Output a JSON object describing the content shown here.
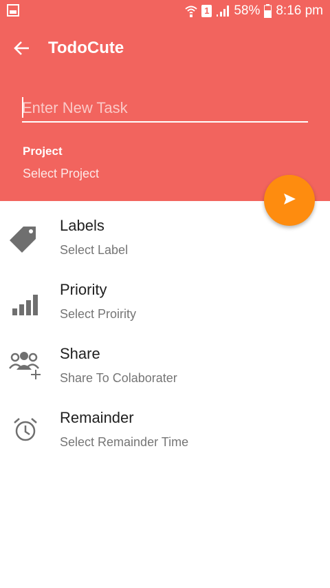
{
  "status_bar": {
    "sim_label": "1",
    "battery": "58%",
    "time": "8:16 pm"
  },
  "app_bar": {
    "title": "TodoCute"
  },
  "task_input": {
    "placeholder": "Enter New Task",
    "value": ""
  },
  "project": {
    "label": "Project",
    "value": "Select Project"
  },
  "options": [
    {
      "title": "Labels",
      "subtitle": "Select Label",
      "icon": "label-tag-icon"
    },
    {
      "title": "Priority",
      "subtitle": "Select Proirity",
      "icon": "signal-bars-icon"
    },
    {
      "title": "Share",
      "subtitle": "Share To Colaborater",
      "icon": "group-add-icon"
    },
    {
      "title": "Remainder",
      "subtitle": "Select Remainder Time",
      "icon": "alarm-clock-icon"
    }
  ],
  "colors": {
    "header": "#f2645e",
    "fab": "#fe8c0f",
    "icon_gray": "#6f6f6f"
  }
}
